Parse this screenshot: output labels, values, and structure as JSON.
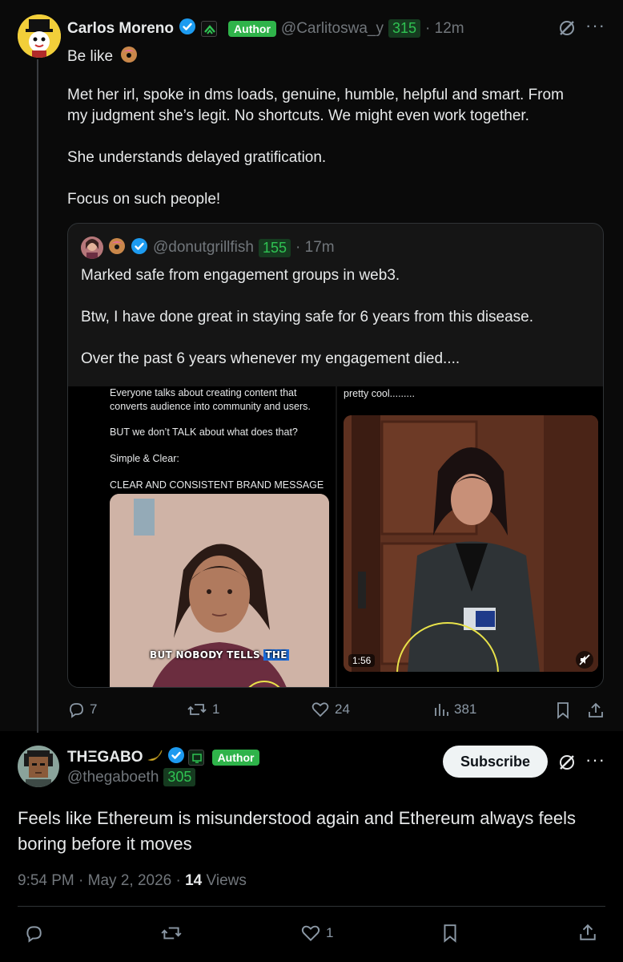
{
  "post1": {
    "name": "Carlos Moreno",
    "author_label": "Author",
    "handle": "@Carlitoswa_y",
    "score": "315",
    "time": "· 12m",
    "line1_prefix": "Be like",
    "paragraph1_line1": "Met her irl, spoke in dms loads, genuine, humble, helpful and smart. From",
    "paragraph1_line2": "my judgment she’s legit. No shortcuts. We might even work together.",
    "paragraph2": "She understands delayed gratification.",
    "paragraph3": "Focus on such people!",
    "quote": {
      "handle": "@donutgrillfish",
      "score": "155",
      "time": "· 17m",
      "line1": "Marked safe from engagement groups in web3.",
      "line2": "Btw, I have done great in staying safe for 6 years from this disease.",
      "line3": "Over the past 6 years whenever my engagement died....",
      "left_media": {
        "text1": "Everyone talks about creating content that",
        "text2": "converts audience into community and users.",
        "text3": "BUT we don’t TALK about what does that?",
        "text4": "Simple & Clear:",
        "text5": "CLEAR AND CONSISTENT BRAND MESSAGE",
        "caption_a": "BUT NOBODY TELLS ",
        "caption_b": "THE"
      },
      "right_media": {
        "caption": "pretty cool.........",
        "duration": "1:56"
      }
    },
    "actions": {
      "replies": "7",
      "reposts": "1",
      "likes": "24",
      "views": "381"
    }
  },
  "post2": {
    "name": "THΞGABO",
    "author_label": "Author",
    "handle": "@thegaboeth",
    "score": "305",
    "subscribe_label": "Subscribe",
    "text_line1": "Feels like Ethereum is misunderstood again and Ethereum always feels",
    "text_line2": "boring before it moves",
    "timestamp": "9:54 PM · May 2, 2026 · ",
    "views_count": "14",
    "views_label": " Views",
    "actions": {
      "likes": "1"
    }
  },
  "colors": {
    "verified": "#1d9bf0",
    "author_badge": "#2fb34a",
    "score_text": "#2fc352",
    "muted": "#71767b"
  }
}
